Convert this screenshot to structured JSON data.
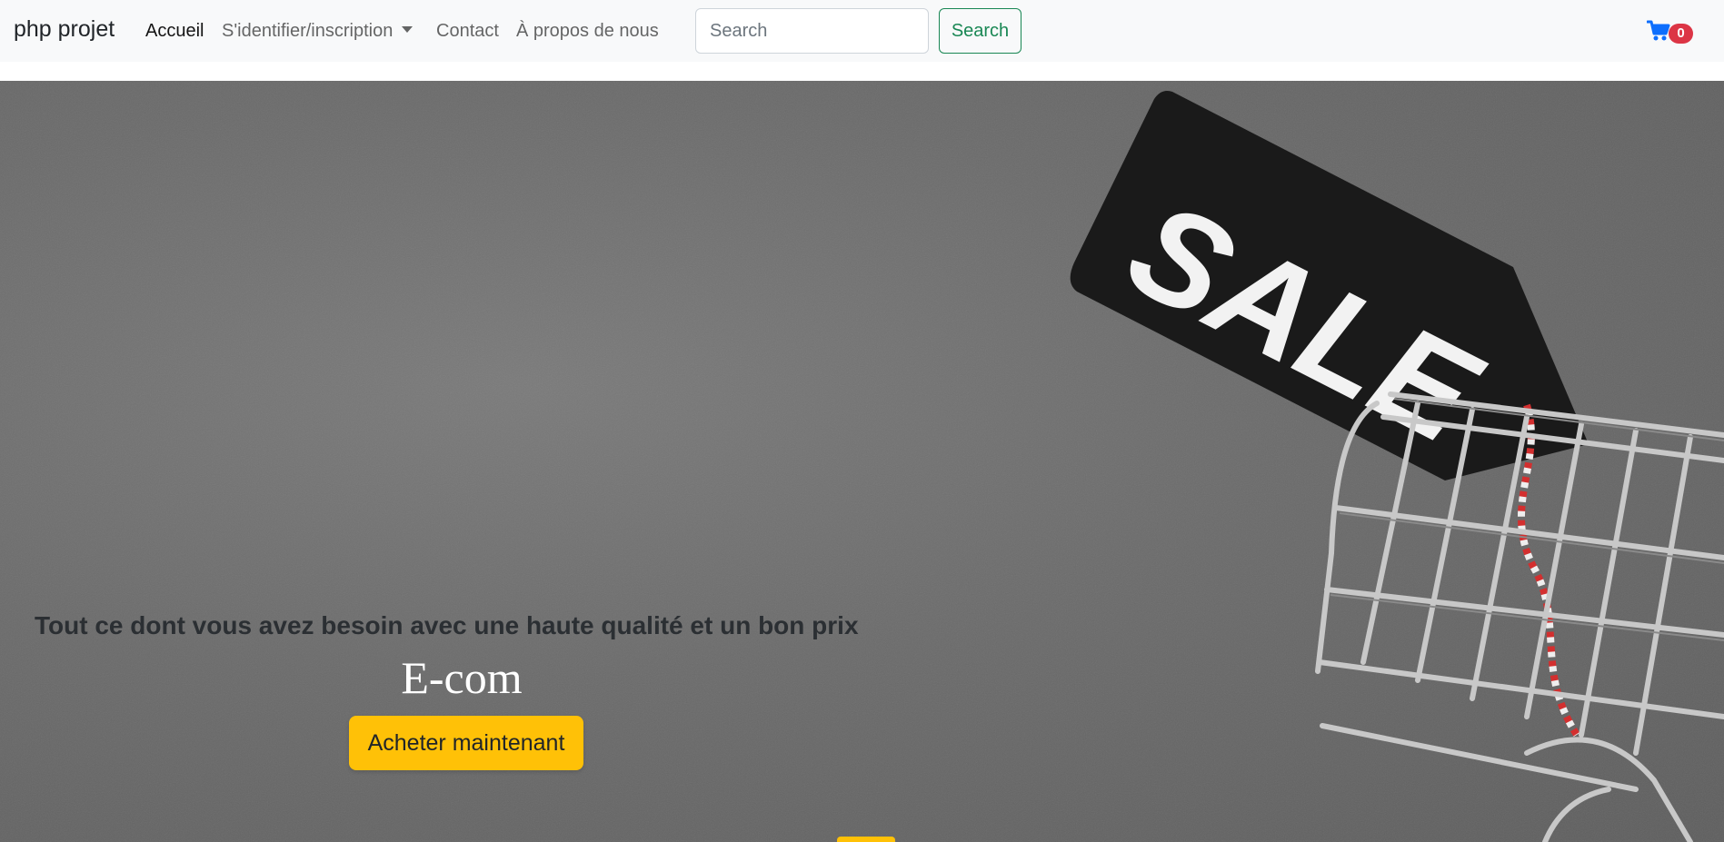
{
  "navbar": {
    "brand": "php projet",
    "links": [
      {
        "label": "Accueil",
        "active": true
      },
      {
        "label": "S'identifier/inscription",
        "dropdown": true
      },
      {
        "label": "Contact"
      },
      {
        "label": "À propos de nous"
      }
    ],
    "search": {
      "placeholder": "Search",
      "value": "",
      "button_label": "Search"
    },
    "cart": {
      "icon": "cart-icon",
      "count": "0"
    }
  },
  "hero": {
    "image_text": "SALE",
    "tagline": "Tout ce dont vous avez besoin avec une haute qualité et un bon prix",
    "title": "E-com",
    "cta_label": "Acheter maintenant"
  },
  "colors": {
    "navbar_bg": "#f8f9fa",
    "search_button": "#198754",
    "badge": "#dc3545",
    "cta": "#ffc107"
  }
}
